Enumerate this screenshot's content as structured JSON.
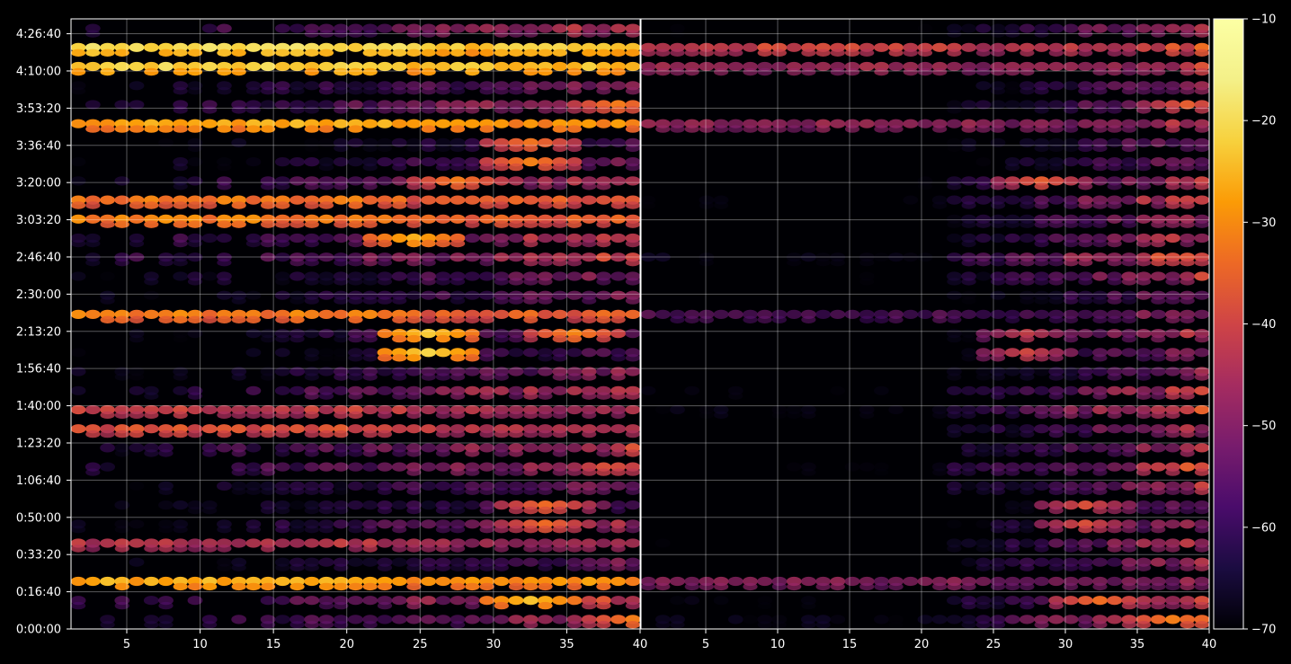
{
  "chart_data": {
    "type": "heatmap",
    "title": "",
    "xlabel": "",
    "ylabel": "",
    "grid": true,
    "panels": [
      {
        "xlim": [
          1.2,
          40
        ],
        "x_ticks": [
          5,
          10,
          15,
          20,
          25,
          30,
          35,
          40
        ],
        "x_tick_labels": [
          "5",
          "10",
          "15",
          "20",
          "25",
          "30",
          "35",
          "40"
        ]
      },
      {
        "xlim": [
          0.5,
          40
        ],
        "x_ticks": [
          5,
          10,
          15,
          20,
          25,
          30,
          35,
          40
        ],
        "x_tick_labels": [
          "5",
          "10",
          "15",
          "20",
          "25",
          "30",
          "35",
          "40"
        ]
      }
    ],
    "y_unit": "seconds",
    "ylim": [
      0,
      16400
    ],
    "y_ticks": [
      0,
      1000,
      2000,
      3000,
      4000,
      5000,
      6000,
      7000,
      8000,
      9000,
      10000,
      11000,
      12000,
      13000,
      14000,
      15000,
      16000
    ],
    "y_tick_labels": [
      "0:00:00",
      "0:16:40",
      "0:33:20",
      "0:50:00",
      "1:06:40",
      "1:23:20",
      "1:40:00",
      "1:56:40",
      "2:13:20",
      "2:30:00",
      "2:46:40",
      "3:03:20",
      "3:20:00",
      "3:36:40",
      "3:53:20",
      "4:10:00",
      "4:26:40"
    ],
    "colorbar": {
      "colormap": "inferno",
      "range": [
        -70,
        -10
      ],
      "ticks": [
        -70,
        -60,
        -50,
        -40,
        -30,
        -20,
        -10
      ],
      "tick_labels": [
        "−70",
        "−60",
        "−50",
        "−40",
        "−30",
        "−20",
        "−10"
      ]
    },
    "x_cells": 39,
    "y_cells": 32,
    "bands": [
      {
        "row": 30.1,
        "panel": 0,
        "value": -16,
        "fade": 0.5
      },
      {
        "row": 29.2,
        "panel": 0,
        "value": -16,
        "fade": 0.6
      },
      {
        "row": 26.0,
        "panel": 0,
        "value": -24,
        "fade": 0.5
      },
      {
        "row": 20.8,
        "panel": 0,
        "value": -26,
        "fade": 0.35
      },
      {
        "row": 22.0,
        "panel": 0,
        "value": -30,
        "fade": 0.4
      },
      {
        "row": 15.9,
        "panel": 0,
        "value": -28,
        "fade": 0.4
      },
      {
        "row": 10.4,
        "panel": 0,
        "value": -30,
        "fade": 0.5
      },
      {
        "row": 4.0,
        "panel": 0,
        "value": -40,
        "fade": 0.6
      },
      {
        "row": 1.6,
        "panel": 0,
        "value": -18,
        "fade": 0.45
      },
      {
        "row": 30.1,
        "panel": 1,
        "value": -36,
        "fade": 0.7
      },
      {
        "row": 29.2,
        "panel": 1,
        "value": -40,
        "fade": 0.8
      },
      {
        "row": 26.0,
        "panel": 1,
        "value": -44,
        "fade": 0.7
      },
      {
        "row": 15.9,
        "panel": 1,
        "value": -50,
        "fade": 0.8
      },
      {
        "row": 1.6,
        "panel": 1,
        "value": -40,
        "fade": 0.7
      }
    ],
    "hotspots": [
      {
        "panel": 0,
        "col": 24,
        "row": 14.4,
        "value": -18
      },
      {
        "panel": 0,
        "col": 23,
        "row": 19.8,
        "value": -24
      },
      {
        "panel": 0,
        "col": 31,
        "row": 1.2,
        "value": -22
      },
      {
        "panel": 0,
        "col": 33,
        "row": 2.0,
        "value": -28
      },
      {
        "panel": 0,
        "col": 38,
        "row": 0.2,
        "value": -30
      },
      {
        "panel": 0,
        "col": 31,
        "row": 24.4,
        "value": -28
      },
      {
        "panel": 0,
        "col": 26,
        "row": 23.0,
        "value": -32
      },
      {
        "panel": 0,
        "col": 32,
        "row": 5.5,
        "value": -30
      },
      {
        "panel": 0,
        "col": 34,
        "row": 14.9,
        "value": -30
      },
      {
        "panel": 0,
        "col": 37,
        "row": 27.0,
        "value": -32
      },
      {
        "panel": 1,
        "col": 36,
        "row": 0.2,
        "value": -30
      },
      {
        "panel": 1,
        "col": 31,
        "row": 1.2,
        "value": -32
      },
      {
        "panel": 1,
        "col": 30,
        "row": 5.5,
        "value": -34
      },
      {
        "panel": 1,
        "col": 26,
        "row": 14.4,
        "value": -36
      },
      {
        "panel": 1,
        "col": 37,
        "row": 27.0,
        "value": -36
      },
      {
        "panel": 1,
        "col": 27,
        "row": 23.0,
        "value": -36
      }
    ]
  }
}
